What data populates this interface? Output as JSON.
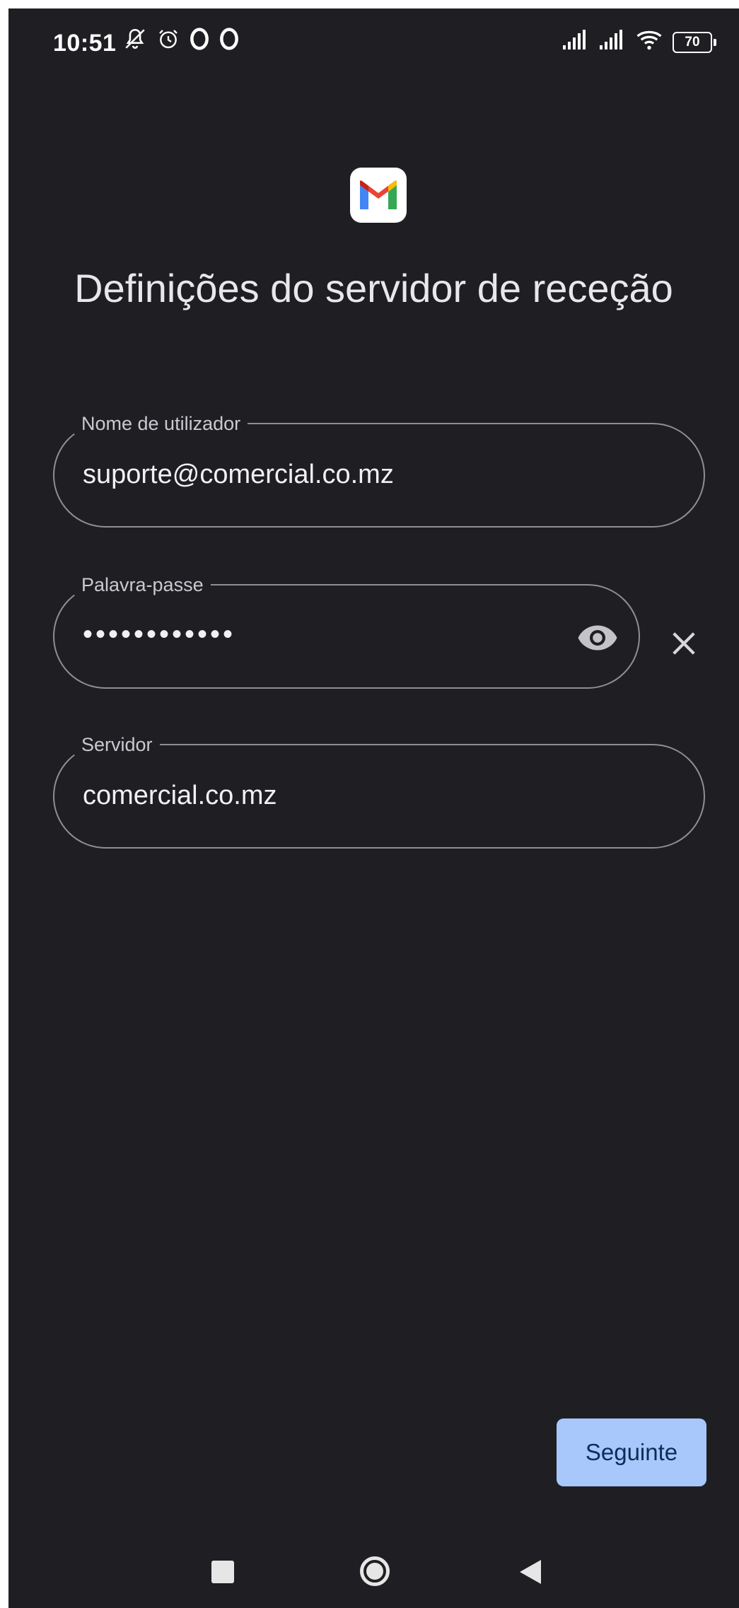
{
  "status_bar": {
    "time": "10:51",
    "battery_level": "70",
    "icons": [
      "do-not-disturb-off-icon",
      "alarm-icon",
      "opera-icon",
      "opera-icon",
      "signal-icon",
      "signal-icon",
      "wifi-icon",
      "battery-icon"
    ]
  },
  "page": {
    "logo": "gmail-logo",
    "title": "Definições do servidor de receção"
  },
  "fields": {
    "username": {
      "label": "Nome de utilizador",
      "value": "suporte@comercial.co.mz"
    },
    "password": {
      "label": "Palavra-passe",
      "value": "••••••••••••"
    },
    "server": {
      "label": "Servidor",
      "value": "comercial.co.mz"
    }
  },
  "actions": {
    "next_label": "Seguinte"
  },
  "colors": {
    "background": "#1f1f23",
    "field_border": "#8e8e94",
    "primary_button": "#a8c7fa",
    "primary_button_text": "#0b2d5a"
  }
}
